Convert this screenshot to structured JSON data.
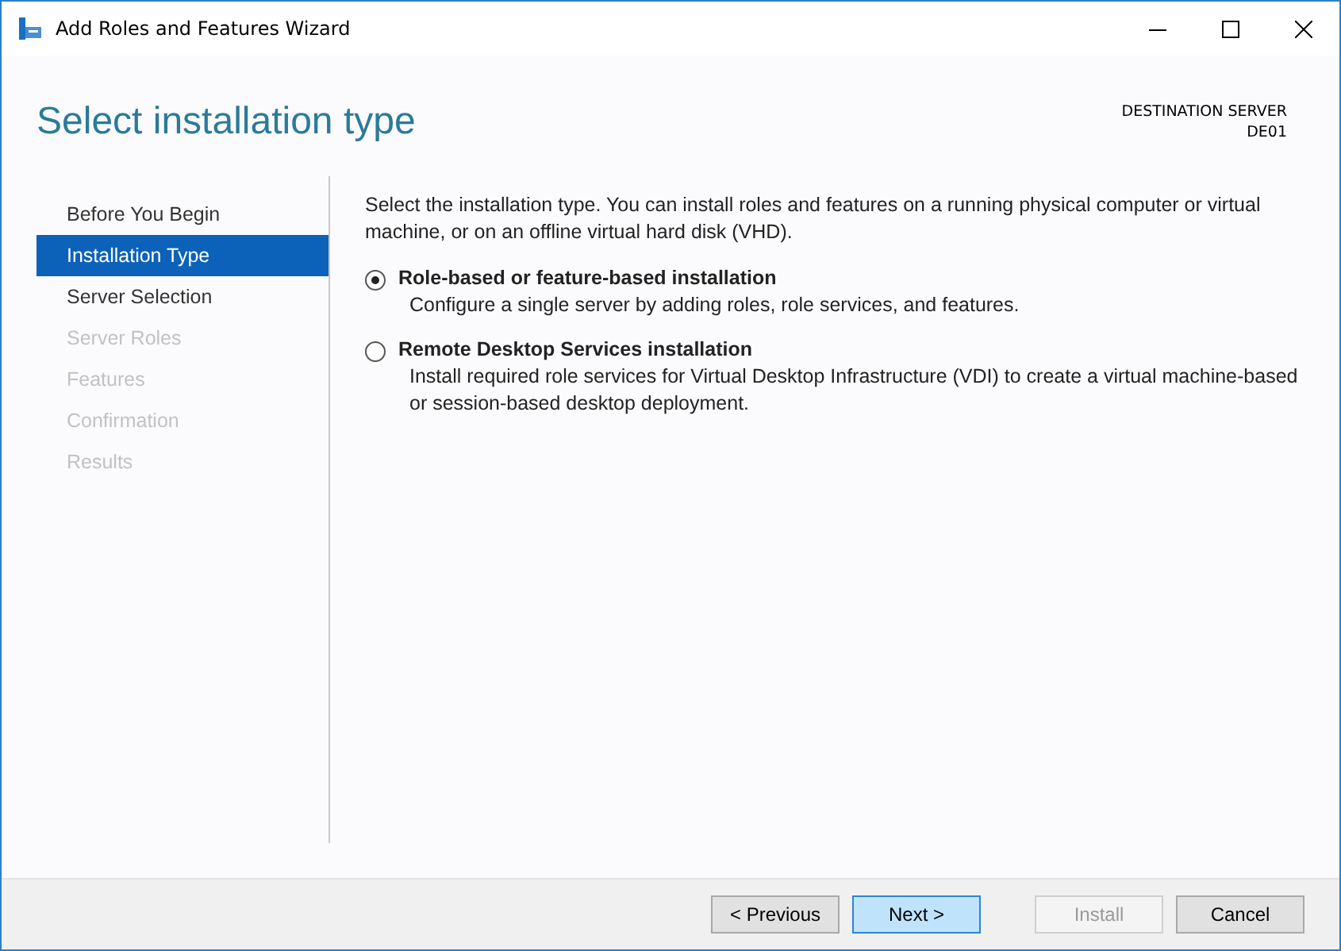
{
  "window": {
    "title": "Add Roles and Features Wizard"
  },
  "header": {
    "title": "Select installation type",
    "destination_label": "DESTINATION SERVER",
    "destination_value": "DE01"
  },
  "nav": [
    {
      "label": "Before You Begin",
      "selected": false,
      "disabled": false
    },
    {
      "label": "Installation Type",
      "selected": true,
      "disabled": false
    },
    {
      "label": "Server Selection",
      "selected": false,
      "disabled": false
    },
    {
      "label": "Server Roles",
      "selected": false,
      "disabled": true
    },
    {
      "label": "Features",
      "selected": false,
      "disabled": true
    },
    {
      "label": "Confirmation",
      "selected": false,
      "disabled": true
    },
    {
      "label": "Results",
      "selected": false,
      "disabled": true
    }
  ],
  "intro": "Select the installation type. You can install roles and features on a running physical computer or virtual machine, or on an offline virtual hard disk (VHD).",
  "options": [
    {
      "label": "Role-based or feature-based installation",
      "description": "Configure a single server by adding roles, role services, and features.",
      "selected": true
    },
    {
      "label": "Remote Desktop Services installation",
      "description": "Install required role services for Virtual Desktop Infrastructure (VDI) to create a virtual machine-based or session-based desktop deployment.",
      "selected": false
    }
  ],
  "buttons": [
    {
      "label": "< Previous",
      "disabled": false,
      "hovered": false
    },
    {
      "label": "Next >",
      "disabled": false,
      "hovered": true
    },
    {
      "label": "Install",
      "disabled": true,
      "hovered": false
    },
    {
      "label": "Cancel",
      "disabled": false,
      "hovered": false
    }
  ]
}
